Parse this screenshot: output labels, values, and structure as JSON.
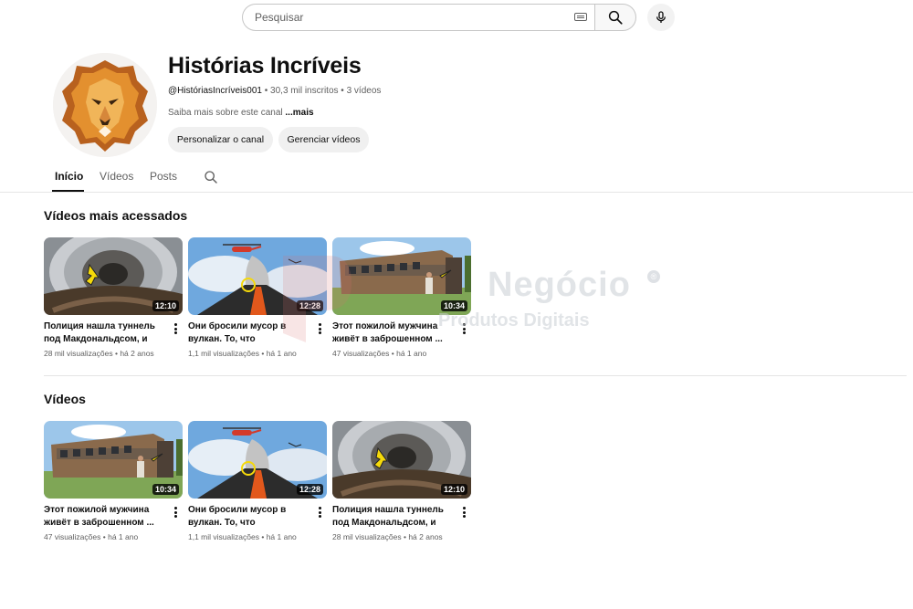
{
  "search": {
    "placeholder": "Pesquisar"
  },
  "channel": {
    "name": "Histórias Incríveis",
    "handle": "@HistóriasIncríveis001",
    "subscribers": "30,3 mil inscritos",
    "videos_count": "3 vídeos",
    "about": "Saiba mais sobre este canal",
    "about_more": "...mais",
    "customize_label": "Personalizar o canal",
    "manage_label": "Gerenciar vídeos"
  },
  "tabs": [
    {
      "label": "Início",
      "active": true
    },
    {
      "label": "Vídeos",
      "active": false
    },
    {
      "label": "Posts",
      "active": false
    }
  ],
  "sections": {
    "popular_title": "Vídeos mais acessados",
    "videos_title": "Vídeos"
  },
  "popular": [
    {
      "title": "Полиция нашла туннель под Макдональдсом, и то,...",
      "views": "28 mil visualizações",
      "age": "há 2 anos",
      "duration": "12:10",
      "thumb": "tunnel"
    },
    {
      "title": "Они бросили мусор в вулкан. То, что произошло...",
      "views": "1,1 mil visualizações",
      "age": "há 1 ano",
      "duration": "12:28",
      "thumb": "volcano"
    },
    {
      "title": "Этот пожилой мужчина живёт в заброшенном ...",
      "views": "47 visualizações",
      "age": "há 1 ano",
      "duration": "10:34",
      "thumb": "train"
    }
  ],
  "videos": [
    {
      "title": "Этот пожилой мужчина живёт в заброшенном ...",
      "views": "47 visualizações",
      "age": "há 1 ano",
      "duration": "10:34",
      "thumb": "train"
    },
    {
      "title": "Они бросили мусор в вулкан. То, что произошло...",
      "views": "1,1 mil visualizações",
      "age": "há 1 ano",
      "duration": "12:28",
      "thumb": "volcano"
    },
    {
      "title": "Полиция нашла туннель под Макдональдсом, и то,...",
      "views": "28 mil visualizações",
      "age": "há 2 anos",
      "duration": "12:10",
      "thumb": "tunnel"
    }
  ],
  "separator": "•",
  "watermark": {
    "text": "Negócio",
    "sub": "Produtos Digitais",
    "reg": "®"
  }
}
